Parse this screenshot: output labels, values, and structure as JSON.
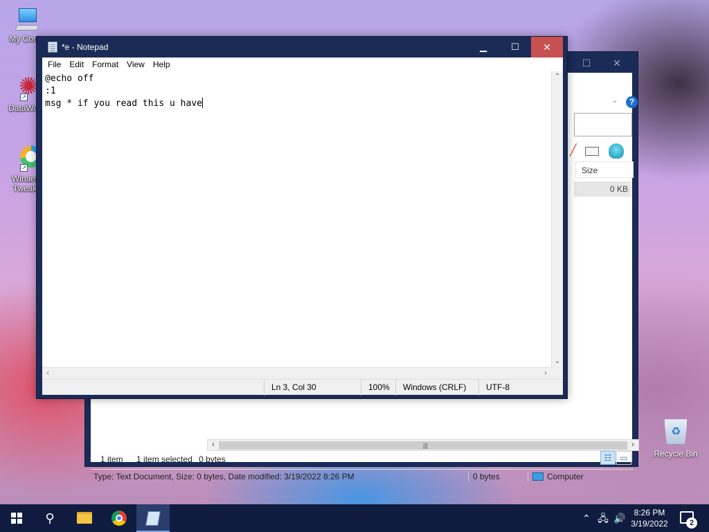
{
  "desktop": {
    "icons": [
      {
        "label": "My Comp",
        "icon": "computer-icon"
      },
      {
        "label": "DataWag",
        "icon": "datawag-icon"
      },
      {
        "label": "Winaer Tweak",
        "icon": "winaero-tweaker-icon"
      }
    ],
    "recycle_bin": {
      "label": "Recycle Bin",
      "icon": "recycle-bin-icon"
    }
  },
  "explorer": {
    "size_header": "Size",
    "size_value": "0 KB",
    "status": {
      "items": "1 item",
      "selected": "1 item selected",
      "bytes": "0 bytes"
    },
    "details_bar": {
      "info": "Type: Text Document, Size: 0 bytes, Date modified: 3/19/2022 8:26 PM",
      "size": "0 bytes",
      "location": "Computer"
    },
    "help_label": "?"
  },
  "notepad": {
    "title": "*e - Notepad",
    "menu": [
      "File",
      "Edit",
      "Format",
      "View",
      "Help"
    ],
    "lines": [
      "@echo off",
      ":1",
      "msg * if you read this u have"
    ],
    "status": {
      "position": "Ln 3, Col 30",
      "zoom": "100%",
      "line_endings": "Windows (CRLF)",
      "encoding": "UTF-8"
    }
  },
  "taskbar": {
    "clock_time": "8:26 PM",
    "clock_date": "3/19/2022",
    "notification_count": "2",
    "active_app": "Notepad",
    "accent": "#0f1c3f"
  }
}
